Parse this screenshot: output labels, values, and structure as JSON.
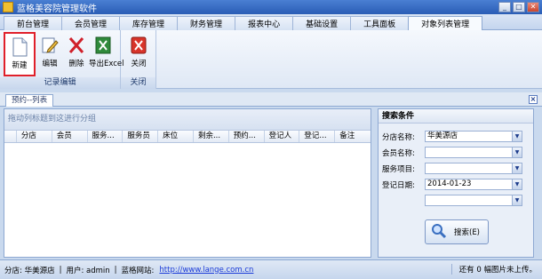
{
  "window": {
    "title": "蓝格美容院管理软件"
  },
  "ribbon_tabs": [
    "前台管理",
    "会员管理",
    "库存管理",
    "财务管理",
    "报表中心",
    "基础设置",
    "工具面板",
    "对象列表管理"
  ],
  "toolbar": {
    "new_label": "新建",
    "edit_label": "编辑",
    "delete_label": "删除",
    "export_label": "导出Excel",
    "close_label": "关闭",
    "group_record_label": "记录编辑",
    "group_close_label": "关闭"
  },
  "doc_tab": {
    "label": "预约--列表"
  },
  "grid": {
    "group_hint": "拖动列标题到这进行分组",
    "columns": [
      "分店",
      "会员",
      "服务...",
      "服务员",
      "床位",
      "剩余...",
      "预约...",
      "登记人",
      "登记...",
      "备注"
    ]
  },
  "search": {
    "title": "搜索条件",
    "branch_label": "分店名称:",
    "branch_value": "华美源店",
    "member_label": "会员名称:",
    "member_value": "",
    "service_label": "服务项目:",
    "service_value": "",
    "date_label": "登记日期:",
    "date_value": "2014-01-23",
    "extra_value": "",
    "search_button": "搜索(E)"
  },
  "status": {
    "branch": "分店: 华美源店",
    "user": "用户: admin",
    "website_label": "蓝格网站:",
    "website_url": "http://www.lange.com.cn",
    "right_text": "还有 0 幅图片未上传。"
  }
}
